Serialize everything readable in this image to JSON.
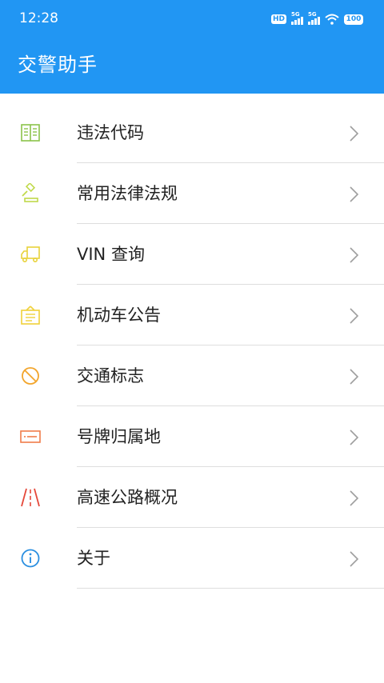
{
  "status_bar": {
    "time": "12:28",
    "hd_badge": "HD",
    "signal1_label": "5G",
    "signal2_label": "5G",
    "battery": "100",
    "icons": [
      "hd-icon",
      "signal-icon",
      "signal-icon",
      "wifi-icon",
      "battery-icon"
    ]
  },
  "app_bar": {
    "title": "交警助手",
    "background_color": "#2196f3"
  },
  "menu": {
    "items": [
      {
        "label": "违法代码",
        "icon": "book-icon",
        "color": "#8bc34a"
      },
      {
        "label": "常用法律法规",
        "icon": "gavel-icon",
        "color": "#c0d94a"
      },
      {
        "label": "VIN 查询",
        "icon": "truck-icon",
        "color": "#e8d23a"
      },
      {
        "label": "机动车公告",
        "icon": "notice-board-icon",
        "color": "#f0d13a"
      },
      {
        "label": "交通标志",
        "icon": "no-entry-sign-icon",
        "color": "#f2a52c"
      },
      {
        "label": "号牌归属地",
        "icon": "license-plate-icon",
        "color": "#f07c4a"
      },
      {
        "label": "高速公路概况",
        "icon": "highway-icon",
        "color": "#e5483a"
      },
      {
        "label": "关于",
        "icon": "info-icon",
        "color": "#2b8fe0"
      }
    ],
    "chevron_icon": "chevron-right-icon"
  }
}
